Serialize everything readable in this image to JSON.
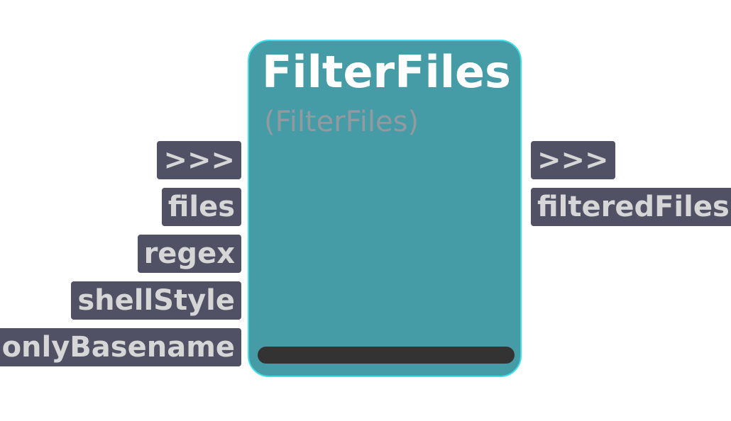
{
  "node": {
    "title": "FilterFiles",
    "subtitle": "(FilterFiles)"
  },
  "inputs": [
    {
      "label": ">>>"
    },
    {
      "label": "files"
    },
    {
      "label": "regex"
    },
    {
      "label": "shellStyle"
    },
    {
      "label": "onlyBasename"
    }
  ],
  "outputs": [
    {
      "label": ">>>"
    },
    {
      "label": "filteredFiles"
    }
  ],
  "colors": {
    "node_fill": "#459ca6",
    "node_border": "#3cdde6",
    "port_fill": "#515165",
    "port_text": "#d6d6d6",
    "title_text": "#ffffff",
    "subtitle_text": "#929aa0",
    "status_bar": "#333333"
  }
}
